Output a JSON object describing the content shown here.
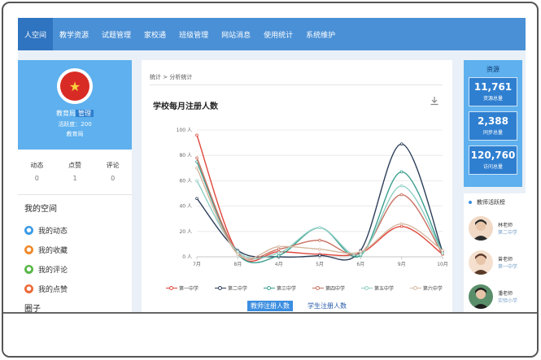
{
  "nav": {
    "items": [
      {
        "label": "人空间",
        "active": true
      },
      {
        "label": "教学资源",
        "active": false
      },
      {
        "label": "试题管理",
        "active": false
      },
      {
        "label": "家校通",
        "active": false
      },
      {
        "label": "班级管理",
        "active": false
      },
      {
        "label": "网站消息",
        "active": false
      },
      {
        "label": "使用统计",
        "active": false
      },
      {
        "label": "系统维护",
        "active": false
      }
    ]
  },
  "profile": {
    "name": "教育局",
    "name_tag": "管理",
    "activity": "活跃度：200",
    "org": "教育局"
  },
  "stats": [
    {
      "label": "动态",
      "value": "0"
    },
    {
      "label": "点赞",
      "value": "1"
    },
    {
      "label": "评论",
      "value": "0"
    }
  ],
  "myspace": {
    "title": "我的空间",
    "items": [
      {
        "label": "我的动态",
        "color": "#3c9be6"
      },
      {
        "label": "我的收藏",
        "color": "#f08a2c"
      },
      {
        "label": "我的评论",
        "color": "#5bb84a"
      },
      {
        "label": "我的点赞",
        "color": "#ee6a3a"
      }
    ],
    "circle_title": "圈子"
  },
  "main": {
    "breadcrumb": "统计 > 分析统计",
    "download_icon": "download-icon",
    "tabs": [
      {
        "label": "教师注册人数",
        "active": true
      },
      {
        "label": "学生注册人数",
        "active": false
      }
    ]
  },
  "chart_data": {
    "type": "line",
    "title": "学校每月注册人数",
    "xlabel": "",
    "ylabel": "",
    "categories": [
      "7月",
      "8月",
      "4月",
      "5月",
      "6月",
      "9月",
      "10月"
    ],
    "yticks": [
      "0 人",
      "20 人",
      "40 人",
      "60 人",
      "80 人",
      "100 人"
    ],
    "ylim": [
      0,
      100
    ],
    "grid": true,
    "legend_position": "bottom",
    "series": [
      {
        "name": "第一中学",
        "color": "#e0473c",
        "values": [
          96,
          3,
          4,
          2,
          3,
          24,
          2
        ]
      },
      {
        "name": "第二中学",
        "color": "#2c3e5a",
        "values": [
          46,
          5,
          0,
          1,
          5,
          89,
          4
        ]
      },
      {
        "name": "第三中学",
        "color": "#3a9e8e",
        "values": [
          75,
          2,
          1,
          23,
          1,
          67,
          3
        ]
      },
      {
        "name": "第四中学",
        "color": "#c96f60",
        "values": [
          78,
          3,
          6,
          13,
          3,
          49,
          2
        ]
      },
      {
        "name": "第五中学",
        "color": "#8fcfc4",
        "values": [
          60,
          4,
          3,
          23,
          2,
          56,
          3
        ]
      },
      {
        "name": "第六中学",
        "color": "#d6b7a0",
        "values": [
          70,
          2,
          8,
          6,
          4,
          26,
          5
        ]
      }
    ]
  },
  "resources": {
    "title": "资源",
    "items": [
      {
        "value": "11,761",
        "label": "资源总量"
      },
      {
        "value": "2,388",
        "label": "同步总量"
      },
      {
        "value": "120,760",
        "label": "访问总量"
      }
    ]
  },
  "teachers": {
    "title": "教师活跃榜",
    "items": [
      {
        "name": "林老师",
        "sub": "第二中学"
      },
      {
        "name": "曾老师",
        "sub": "第一中学"
      },
      {
        "name": "潘老师",
        "sub": "实验小学"
      }
    ]
  }
}
